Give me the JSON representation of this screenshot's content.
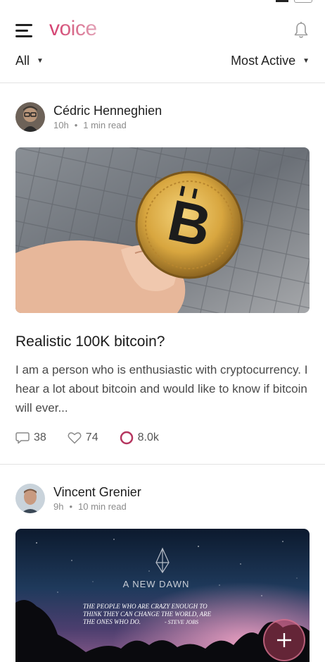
{
  "app": {
    "logo": "voice"
  },
  "filters": {
    "left_label": "All",
    "right_label": "Most Active"
  },
  "posts": [
    {
      "author": "Cédric Henneghien",
      "time": "10h",
      "read_time": "1 min read",
      "title": "Realistic 100K bitcoin?",
      "excerpt": "I am a person who is enthusiastic with cryptocurrency. I hear a lot about bitcoin and would like to know if bitcoin will ever...",
      "comments": "38",
      "likes": "74",
      "tokens": "8.0k"
    },
    {
      "author": "Vincent Grenier",
      "time": "9h",
      "read_time": "10 min read",
      "image_text": {
        "heading": "A NEW DAWN",
        "quote": "THE PEOPLE WHO ARE CRAZY ENOUGH TO THINK THEY CAN CHANGE THE WORLD, ARE THE ONES WHO DO.",
        "attribution": "- STEVE JOBS"
      }
    }
  ],
  "icons": {
    "menu": "menu-icon",
    "bell": "bell-icon",
    "comment": "comment-icon",
    "heart": "heart-icon",
    "token": "token-ring-icon",
    "add": "plus-icon"
  },
  "colors": {
    "brand": "#d43c6e",
    "token_ring": "#b5365f",
    "fab": "#af3c5a"
  },
  "meta_separator": "•"
}
